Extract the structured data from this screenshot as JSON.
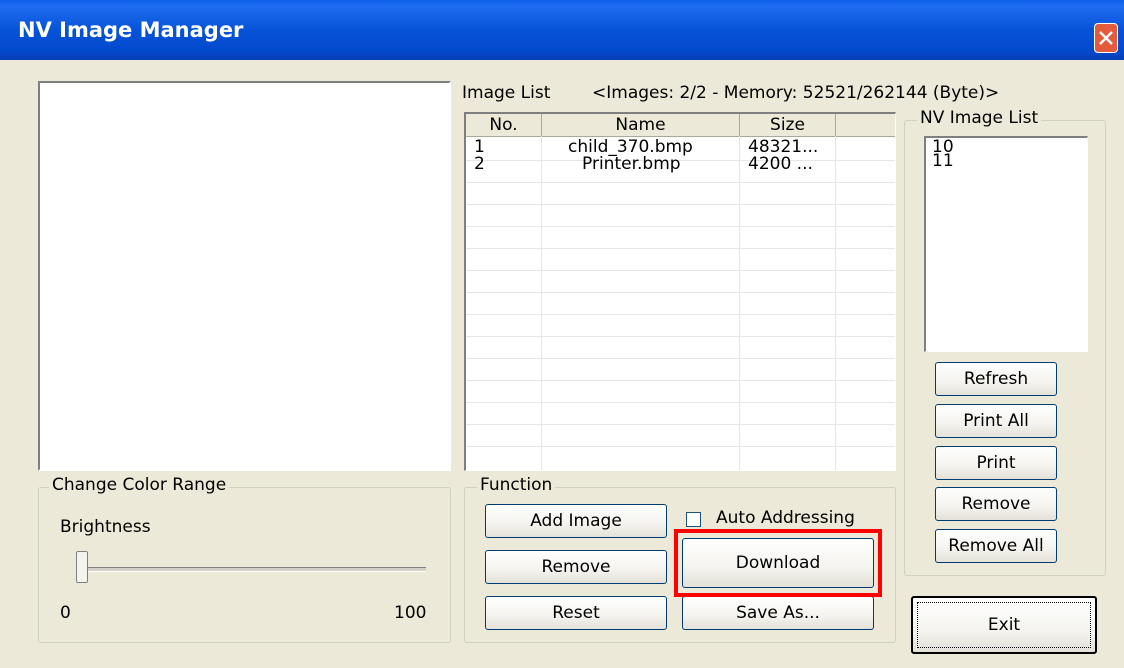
{
  "window": {
    "title": "NV Image Manager"
  },
  "image_list": {
    "label": "Image List",
    "summary": "<Images: 2/2 - Memory: 52521/262144 (Byte)>",
    "columns": [
      "No.",
      "Name",
      "Size"
    ],
    "rows": [
      {
        "no": "1",
        "name": "child_370.bmp",
        "size": "48321..."
      },
      {
        "no": "2",
        "name": "Printer.bmp",
        "size": "4200 ..."
      }
    ]
  },
  "nv_list": {
    "label": "NV Image List",
    "items": [
      "10",
      "11"
    ],
    "buttons": {
      "refresh": "Refresh",
      "print_all": "Print All",
      "print": "Print",
      "remove": "Remove",
      "remove_all": "Remove All"
    }
  },
  "color_range": {
    "label": "Change Color Range",
    "brightness_label": "Brightness",
    "min": "0",
    "max": "100",
    "value": 0
  },
  "function": {
    "label": "Function",
    "add_image": "Add Image",
    "auto_addressing": "Auto Addressing",
    "remove": "Remove",
    "download": "Download",
    "reset": "Reset",
    "save_as": "Save As..."
  },
  "exit": "Exit",
  "colors": {
    "title_bar": "#0653d8",
    "face": "#ece9d8",
    "highlight": "#ff0000",
    "close": "#e35b3b"
  }
}
